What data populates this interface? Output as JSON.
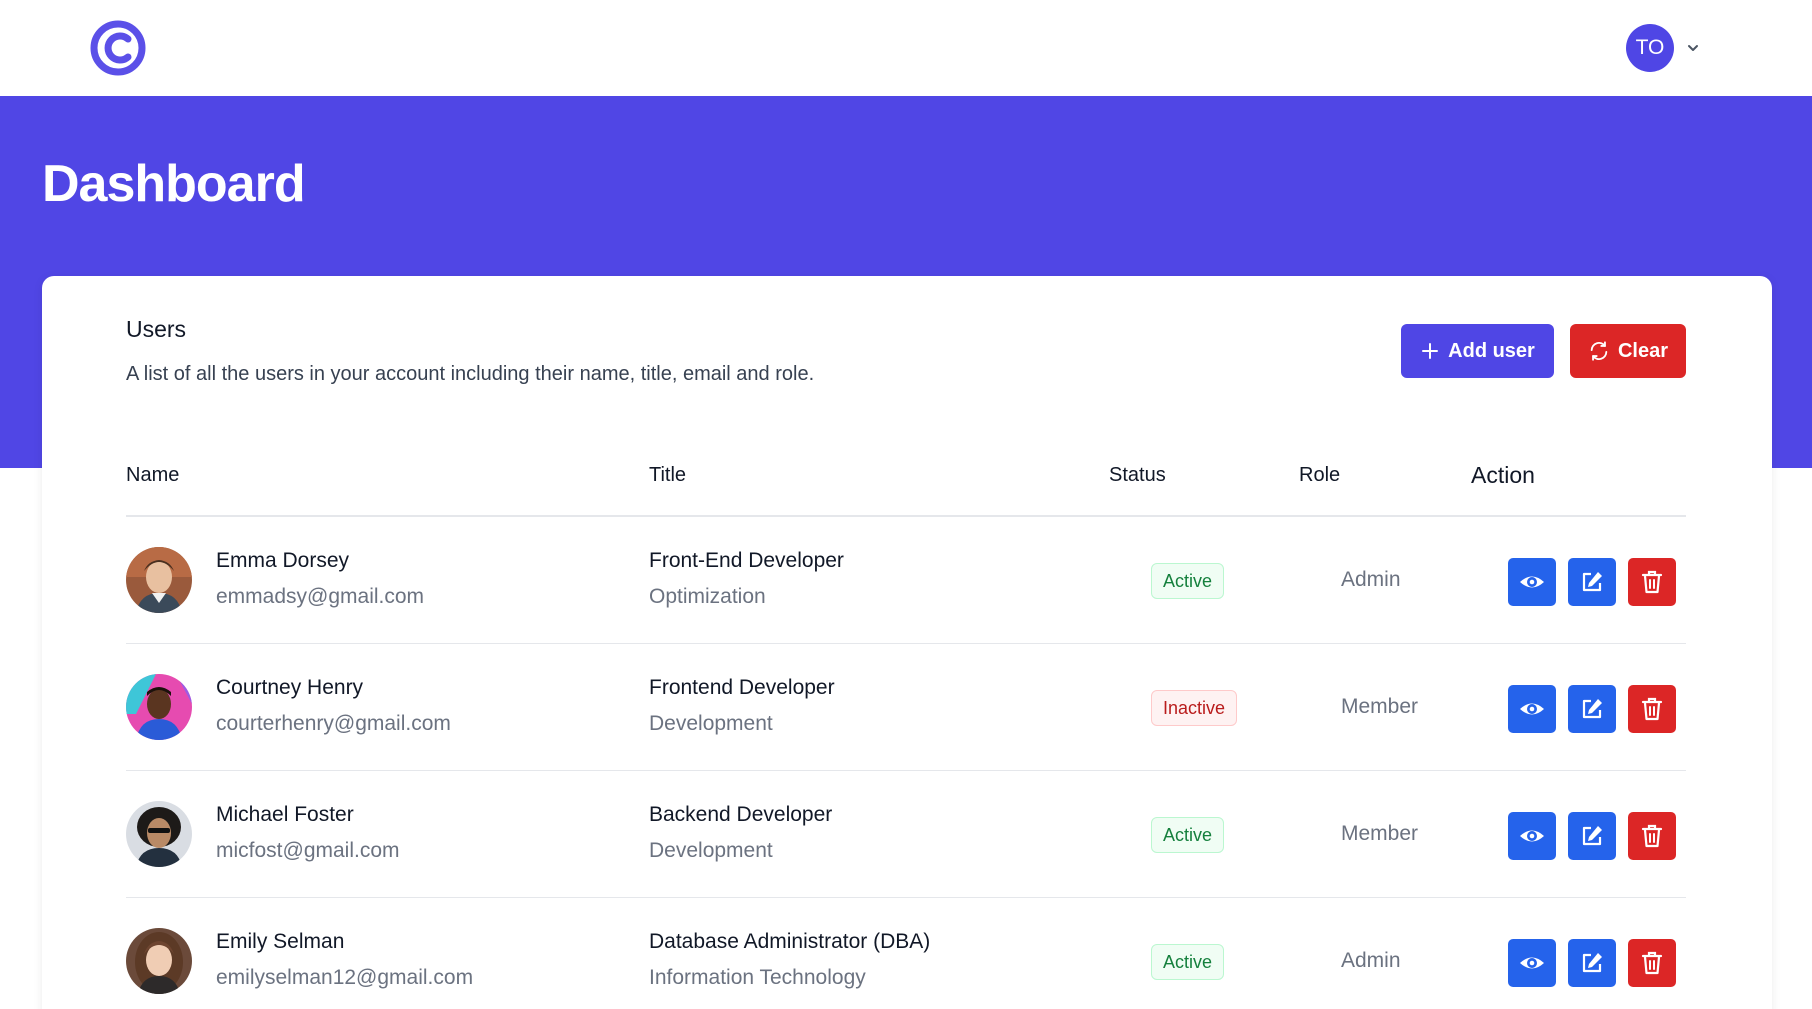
{
  "header": {
    "logo_icon": "c-logo-icon",
    "user_initials": "TO",
    "menu_icon": "chevron-down-icon"
  },
  "page": {
    "title": "Dashboard"
  },
  "users_card": {
    "title": "Users",
    "description": "A list of all the users in your account including their name, title, email and role.",
    "add_button": "Add user",
    "clear_button": "Clear"
  },
  "table": {
    "columns": {
      "name": "Name",
      "title": "Title",
      "status": "Status",
      "role": "Role",
      "action": "Action"
    },
    "rows": [
      {
        "name": "Emma Dorsey",
        "email": "emmadsy@gmail.com",
        "job_title": "Front-End Developer",
        "department": "Optimization",
        "status": "Active",
        "role": "Admin"
      },
      {
        "name": "Courtney Henry",
        "email": "courterhenry@gmail.com",
        "job_title": "Frontend Developer",
        "department": "Development",
        "status": "Inactive",
        "role": "Member"
      },
      {
        "name": "Michael Foster",
        "email": "micfost@gmail.com",
        "job_title": "Backend Developer",
        "department": "Development",
        "status": "Active",
        "role": "Member"
      },
      {
        "name": "Emily Selman",
        "email": "emilyselman12@gmail.com",
        "job_title": "Database Administrator (DBA)",
        "department": "Information Technology",
        "status": "Active",
        "role": "Admin"
      }
    ]
  },
  "colors": {
    "brand": "#4f46e5",
    "banner": "#5046e5",
    "action_blue": "#2563eb",
    "danger": "#dc2626",
    "active_green": "#15803d",
    "inactive_red": "#b91c1c"
  }
}
